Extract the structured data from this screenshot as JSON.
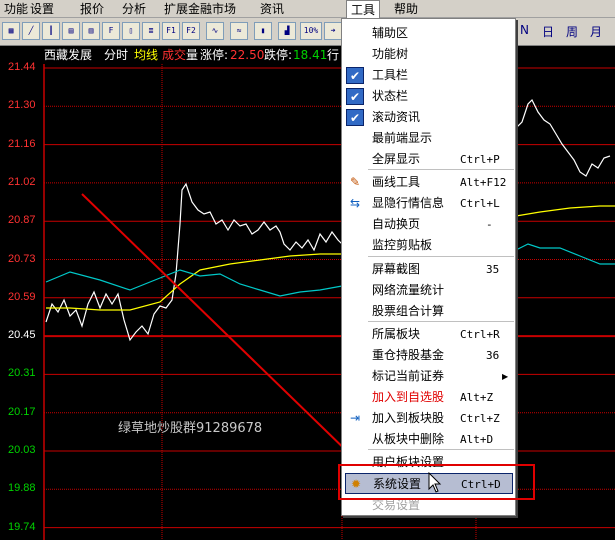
{
  "menubar": {
    "items": [
      "功能",
      "设置",
      "报价",
      "分析",
      "扩展金融市场",
      "资讯",
      "工具",
      "帮助"
    ],
    "active_item": "工具"
  },
  "toolbar": {
    "period_buttons": [
      "N",
      "日",
      "周",
      "月"
    ],
    "buttons": [
      "F1",
      "F2",
      "10%"
    ]
  },
  "infobar": {
    "stock_name": "西藏发展",
    "chart_type": "分时",
    "avg_line_label": "均线",
    "volume_label_a": "成交",
    "volume_label_b": "量",
    "limit_up_label": "涨停:",
    "limit_up_value": "22.50",
    "limit_down_label": "跌停:",
    "limit_down_value": "18.41",
    "trailing": "行"
  },
  "chart": {
    "price_axis": [
      "21.44",
      "21.30",
      "21.16",
      "21.02",
      "20.87",
      "20.73",
      "20.59",
      "20.45",
      "20.31",
      "20.17",
      "20.03",
      "19.88",
      "19.74"
    ],
    "watermark": "绿草地炒股群91289678",
    "colors": {
      "up": "#ff3232",
      "down": "#00d200",
      "price_line": "#ffffff",
      "avg_line": "#ffff00",
      "cyan_line": "#00c8c8",
      "grid": "#c80000"
    }
  },
  "dropdown": {
    "items": [
      {
        "label": "辅助区",
        "shortcut": "",
        "icon": "",
        "checked": false
      },
      {
        "label": "功能树",
        "shortcut": "",
        "icon": "",
        "checked": false
      },
      {
        "label": "工具栏",
        "shortcut": "",
        "icon": "check-icon",
        "checked": true
      },
      {
        "label": "状态栏",
        "shortcut": "",
        "icon": "check-icon",
        "checked": true
      },
      {
        "label": "滚动资讯",
        "shortcut": "",
        "icon": "check-icon",
        "checked": true
      },
      {
        "label": "最前端显示",
        "shortcut": "",
        "icon": "",
        "checked": false
      },
      {
        "label": "全屏显示",
        "shortcut": "Ctrl+P",
        "icon": "",
        "checked": false
      },
      {
        "label": "画线工具",
        "shortcut": "Alt+F12",
        "icon": "pencil-icon",
        "checked": false
      },
      {
        "label": "显隐行情信息",
        "shortcut": "Ctrl+L",
        "icon": "toggle-info-icon",
        "checked": false
      },
      {
        "label": "自动换页",
        "shortcut": "-",
        "icon": "",
        "checked": false
      },
      {
        "label": "监控剪贴板",
        "shortcut": "",
        "icon": "",
        "checked": false
      },
      {
        "label": "屏幕截图",
        "shortcut": "35",
        "icon": "",
        "checked": false
      },
      {
        "label": "网络流量统计",
        "shortcut": "",
        "icon": "",
        "checked": false
      },
      {
        "label": "股票组合计算",
        "shortcut": "",
        "icon": "",
        "checked": false
      },
      {
        "label": "所属板块",
        "shortcut": "Ctrl+R",
        "icon": "",
        "checked": false
      },
      {
        "label": "重仓持股基金",
        "shortcut": "36",
        "icon": "",
        "checked": false
      },
      {
        "label": "标记当前证券",
        "shortcut": "",
        "icon": "",
        "checked": false
      },
      {
        "label": "加入到自选股",
        "shortcut": "Alt+Z",
        "icon": "",
        "checked": false
      },
      {
        "label": "加入到板块股",
        "shortcut": "Ctrl+Z",
        "icon": "add-to-block-icon",
        "checked": false
      },
      {
        "label": "从板块中删除",
        "shortcut": "Alt+D",
        "icon": "",
        "checked": false
      },
      {
        "label": "用户板块设置",
        "shortcut": "",
        "icon": "",
        "checked": false
      },
      {
        "label": "系统设置",
        "shortcut": "Ctrl+D",
        "icon": "gear-icon",
        "checked": false
      },
      {
        "label": "交易设置",
        "shortcut": "",
        "icon": "",
        "checked": false
      }
    ]
  }
}
